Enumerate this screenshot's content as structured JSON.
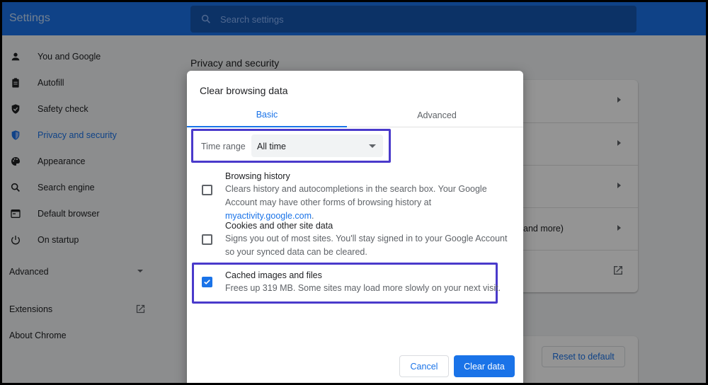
{
  "app": {
    "title": "Settings"
  },
  "search": {
    "placeholder": "Search settings"
  },
  "sidebar": {
    "items": [
      {
        "label": "You and Google",
        "icon": "person-icon"
      },
      {
        "label": "Autofill",
        "icon": "clipboard-icon"
      },
      {
        "label": "Safety check",
        "icon": "shield-check-icon"
      },
      {
        "label": "Privacy and security",
        "icon": "shield-icon",
        "active": true
      },
      {
        "label": "Appearance",
        "icon": "palette-icon"
      },
      {
        "label": "Search engine",
        "icon": "search-icon"
      },
      {
        "label": "Default browser",
        "icon": "browser-icon"
      },
      {
        "label": "On startup",
        "icon": "power-icon"
      }
    ],
    "advanced": "Advanced",
    "extensions": "Extensions",
    "about": "About Chrome"
  },
  "main": {
    "section_title": "Privacy and security",
    "partial_row_text": "and more)",
    "reset_label": "Reset to default"
  },
  "dialog": {
    "title": "Clear browsing data",
    "tabs": [
      "Basic",
      "Advanced"
    ],
    "time_range_label": "Time range",
    "time_range_value": "All time",
    "options": [
      {
        "title": "Browsing history",
        "desc_prefix": "Clears history and autocompletions in the search box. Your Google Account may have other forms of browsing history at ",
        "desc_link": "myactivity.google.com",
        "desc_suffix": ".",
        "checked": false
      },
      {
        "title": "Cookies and other site data",
        "desc": "Signs you out of most sites. You'll stay signed in to your Google Account so your synced data can be cleared.",
        "checked": false
      },
      {
        "title": "Cached images and files",
        "desc": "Frees up 319 MB. Some sites may load more slowly on your next visit.",
        "checked": true
      }
    ],
    "cancel_label": "Cancel",
    "clear_label": "Clear data"
  },
  "colors": {
    "accent": "#1a73e8",
    "highlight_box": "#4a3acb"
  }
}
